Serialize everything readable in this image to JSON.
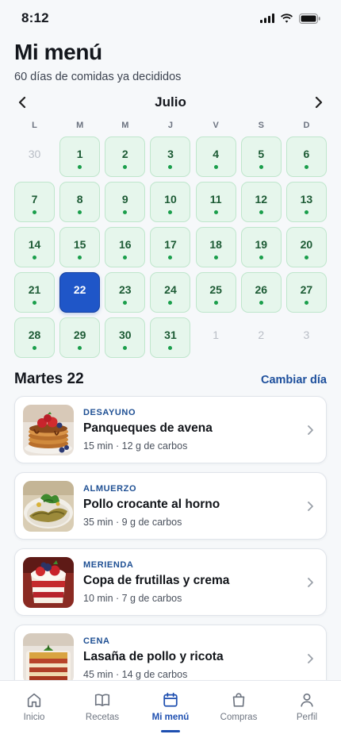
{
  "status_bar": {
    "time": "8:12"
  },
  "header": {
    "title": "Mi menú",
    "subtitle": "60 días de comidas ya decididos"
  },
  "calendar": {
    "month": "Julio",
    "weekdays": [
      "L",
      "M",
      "M",
      "J",
      "V",
      "S",
      "D"
    ],
    "selected_day": "22",
    "days": [
      {
        "n": "30",
        "in_month": false
      },
      {
        "n": "1",
        "in_month": true
      },
      {
        "n": "2",
        "in_month": true
      },
      {
        "n": "3",
        "in_month": true
      },
      {
        "n": "4",
        "in_month": true
      },
      {
        "n": "5",
        "in_month": true
      },
      {
        "n": "6",
        "in_month": true
      },
      {
        "n": "7",
        "in_month": true
      },
      {
        "n": "8",
        "in_month": true
      },
      {
        "n": "9",
        "in_month": true
      },
      {
        "n": "10",
        "in_month": true
      },
      {
        "n": "11",
        "in_month": true
      },
      {
        "n": "12",
        "in_month": true
      },
      {
        "n": "13",
        "in_month": true
      },
      {
        "n": "14",
        "in_month": true
      },
      {
        "n": "15",
        "in_month": true
      },
      {
        "n": "16",
        "in_month": true
      },
      {
        "n": "17",
        "in_month": true
      },
      {
        "n": "18",
        "in_month": true
      },
      {
        "n": "19",
        "in_month": true
      },
      {
        "n": "20",
        "in_month": true
      },
      {
        "n": "21",
        "in_month": true
      },
      {
        "n": "22",
        "in_month": true
      },
      {
        "n": "23",
        "in_month": true
      },
      {
        "n": "24",
        "in_month": true
      },
      {
        "n": "25",
        "in_month": true
      },
      {
        "n": "26",
        "in_month": true
      },
      {
        "n": "27",
        "in_month": true
      },
      {
        "n": "28",
        "in_month": true
      },
      {
        "n": "29",
        "in_month": true
      },
      {
        "n": "30",
        "in_month": true
      },
      {
        "n": "31",
        "in_month": true
      },
      {
        "n": "1",
        "in_month": false
      },
      {
        "n": "2",
        "in_month": false
      },
      {
        "n": "3",
        "in_month": false
      }
    ]
  },
  "day_section": {
    "heading": "Martes 22",
    "change_label": "Cambiar día"
  },
  "meals": [
    {
      "type": "DESAYUNO",
      "name": "Panqueques de avena",
      "meta": "15 min · 12 g de carbos",
      "icon": "pancakes-photo"
    },
    {
      "type": "ALMUERZO",
      "name": "Pollo crocante al horno",
      "meta": "35 min · 9 g de carbos",
      "icon": "baked-chicken-photo"
    },
    {
      "type": "MERIENDA",
      "name": "Copa de frutillas y crema",
      "meta": "10 min · 7 g de carbos",
      "icon": "strawberry-cup-photo"
    },
    {
      "type": "CENA",
      "name": "Lasaña de pollo y ricota",
      "meta": "45 min · 14 g de carbos",
      "icon": "lasagna-photo"
    }
  ],
  "bottom_nav": [
    {
      "label": "Inicio",
      "icon": "home-icon",
      "active": false
    },
    {
      "label": "Recetas",
      "icon": "book-icon",
      "active": false
    },
    {
      "label": "Mi menú",
      "icon": "calendar-icon",
      "active": true
    },
    {
      "label": "Compras",
      "icon": "shopping-bag-icon",
      "active": false
    },
    {
      "label": "Perfil",
      "icon": "person-icon",
      "active": false
    }
  ],
  "colors": {
    "accent": "#1f56c8",
    "day_fill": "#e6f6ec",
    "day_dot": "#1a9e4b",
    "meal_type": "#1e4f93"
  }
}
